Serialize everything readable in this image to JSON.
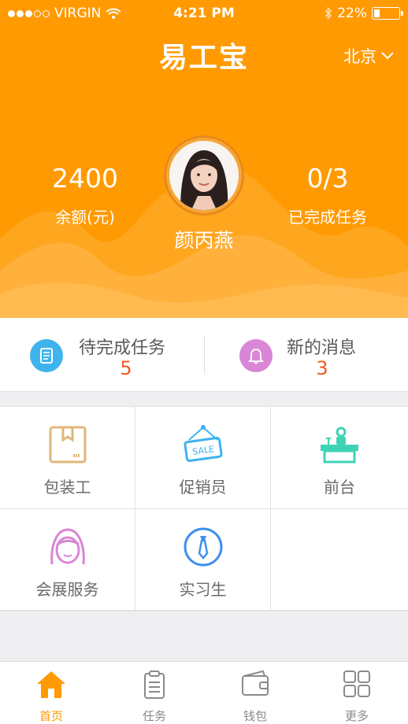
{
  "status_bar": {
    "carrier": "VIRGIN",
    "time": "4:21 PM",
    "battery": "22%",
    "battery_level": 0.22
  },
  "header": {
    "title": "易工宝",
    "city": "北京"
  },
  "profile": {
    "balance_value": "2400",
    "balance_label": "余额(元)",
    "tasks_done_value": "0/3",
    "tasks_done_label": "已完成任务",
    "name": "颜丙燕"
  },
  "info_bar": {
    "pending_label": "待完成任务",
    "pending_value": "5",
    "messages_label": "新的消息",
    "messages_value": "3"
  },
  "categories": [
    {
      "label": "包装工",
      "icon": "package-box-icon"
    },
    {
      "label": "促销员",
      "icon": "sale-sign-icon"
    },
    {
      "label": "前台",
      "icon": "front-desk-icon"
    },
    {
      "label": "会展服务",
      "icon": "hostess-face-icon"
    },
    {
      "label": "实习生",
      "icon": "tie-icon"
    }
  ],
  "tabs": [
    {
      "label": "首页",
      "icon": "home-icon",
      "active": true
    },
    {
      "label": "任务",
      "icon": "clipboard-icon",
      "active": false
    },
    {
      "label": "钱包",
      "icon": "wallet-icon",
      "active": false
    },
    {
      "label": "更多",
      "icon": "grid-more-icon",
      "active": false
    }
  ],
  "colors": {
    "brand_orange": "#ff9a02",
    "accent_red": "#f15a24"
  }
}
